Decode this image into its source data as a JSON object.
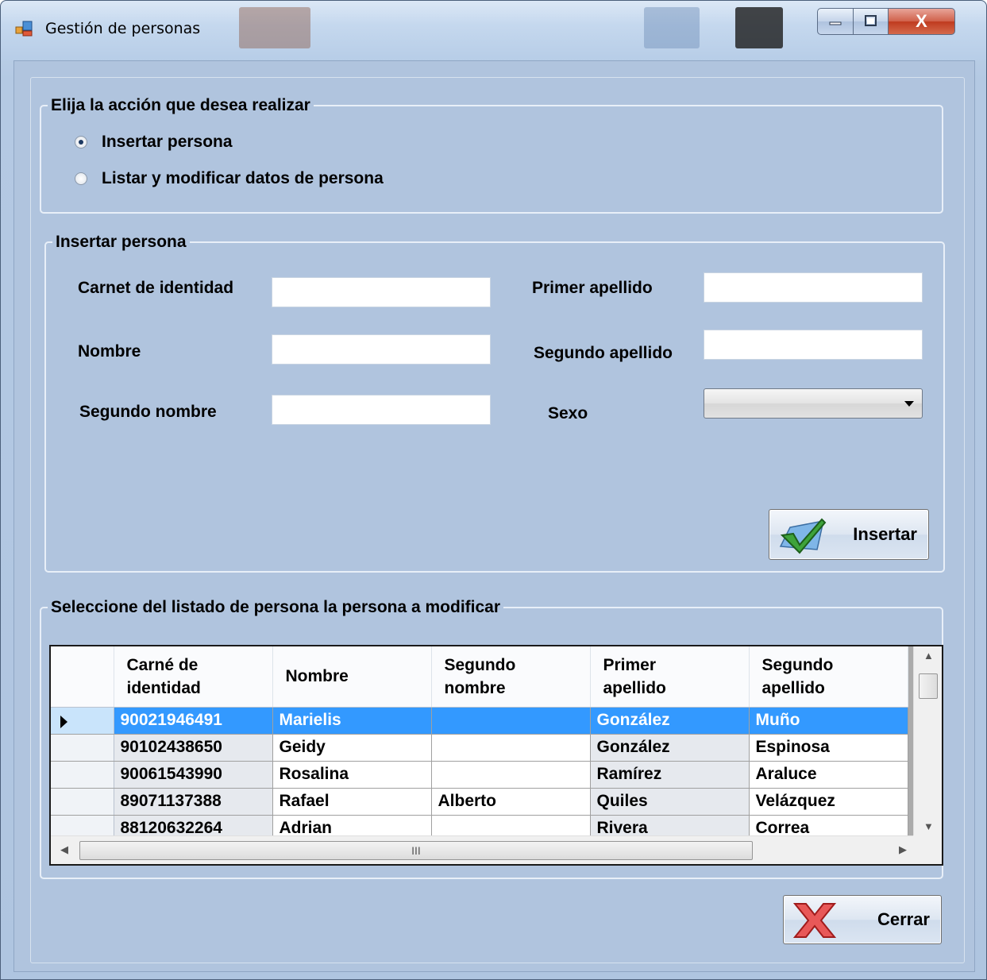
{
  "window": {
    "title": "Gestión de personas",
    "close_glyph": "X"
  },
  "action_group": {
    "title": "Elija la acción que desea realizar",
    "options": [
      {
        "label": "Insertar persona",
        "checked": true
      },
      {
        "label": "Listar y modificar datos de persona",
        "checked": false
      }
    ]
  },
  "insert_group": {
    "title": "Insertar persona",
    "fields": {
      "carnet_label": "Carnet de identidad",
      "carnet_value": "",
      "nombre_label": "Nombre",
      "nombre_value": "",
      "segundo_nombre_label": "Segundo nombre",
      "segundo_nombre_value": "",
      "primer_apellido_label": "Primer apellido",
      "primer_apellido_value": "",
      "segundo_apellido_label": "Segundo apellido",
      "segundo_apellido_value": "",
      "sexo_label": "Sexo",
      "sexo_value": ""
    },
    "insert_button": "Insertar"
  },
  "list_group": {
    "title": "Seleccione del listado de persona la persona a modificar",
    "columns": [
      [
        "Carné de",
        "identidad"
      ],
      [
        "Nombre"
      ],
      [
        "Segundo",
        "nombre"
      ],
      [
        "Primer",
        "apellido"
      ],
      [
        "Segundo",
        "apellido"
      ]
    ],
    "rows": [
      [
        "90021946491",
        "Marielis",
        "",
        "González",
        "Muño"
      ],
      [
        "90102438650",
        "Geidy",
        "",
        "González",
        "Espinosa"
      ],
      [
        "90061543990",
        "Rosalina",
        "",
        "Ramírez",
        "Araluce"
      ],
      [
        "89071137388",
        "Rafael",
        "Alberto",
        "Quiles",
        "Velázquez"
      ],
      [
        "88120632264",
        "Adrian",
        "",
        "Rivera",
        "Correa"
      ]
    ],
    "selected_row": 0,
    "hscroll_grip": "III"
  },
  "close_button": "Cerrar",
  "colors": {
    "form_bg": "#b0c4de",
    "selection": "#3399ff",
    "close_red": "#bf3a1f"
  }
}
